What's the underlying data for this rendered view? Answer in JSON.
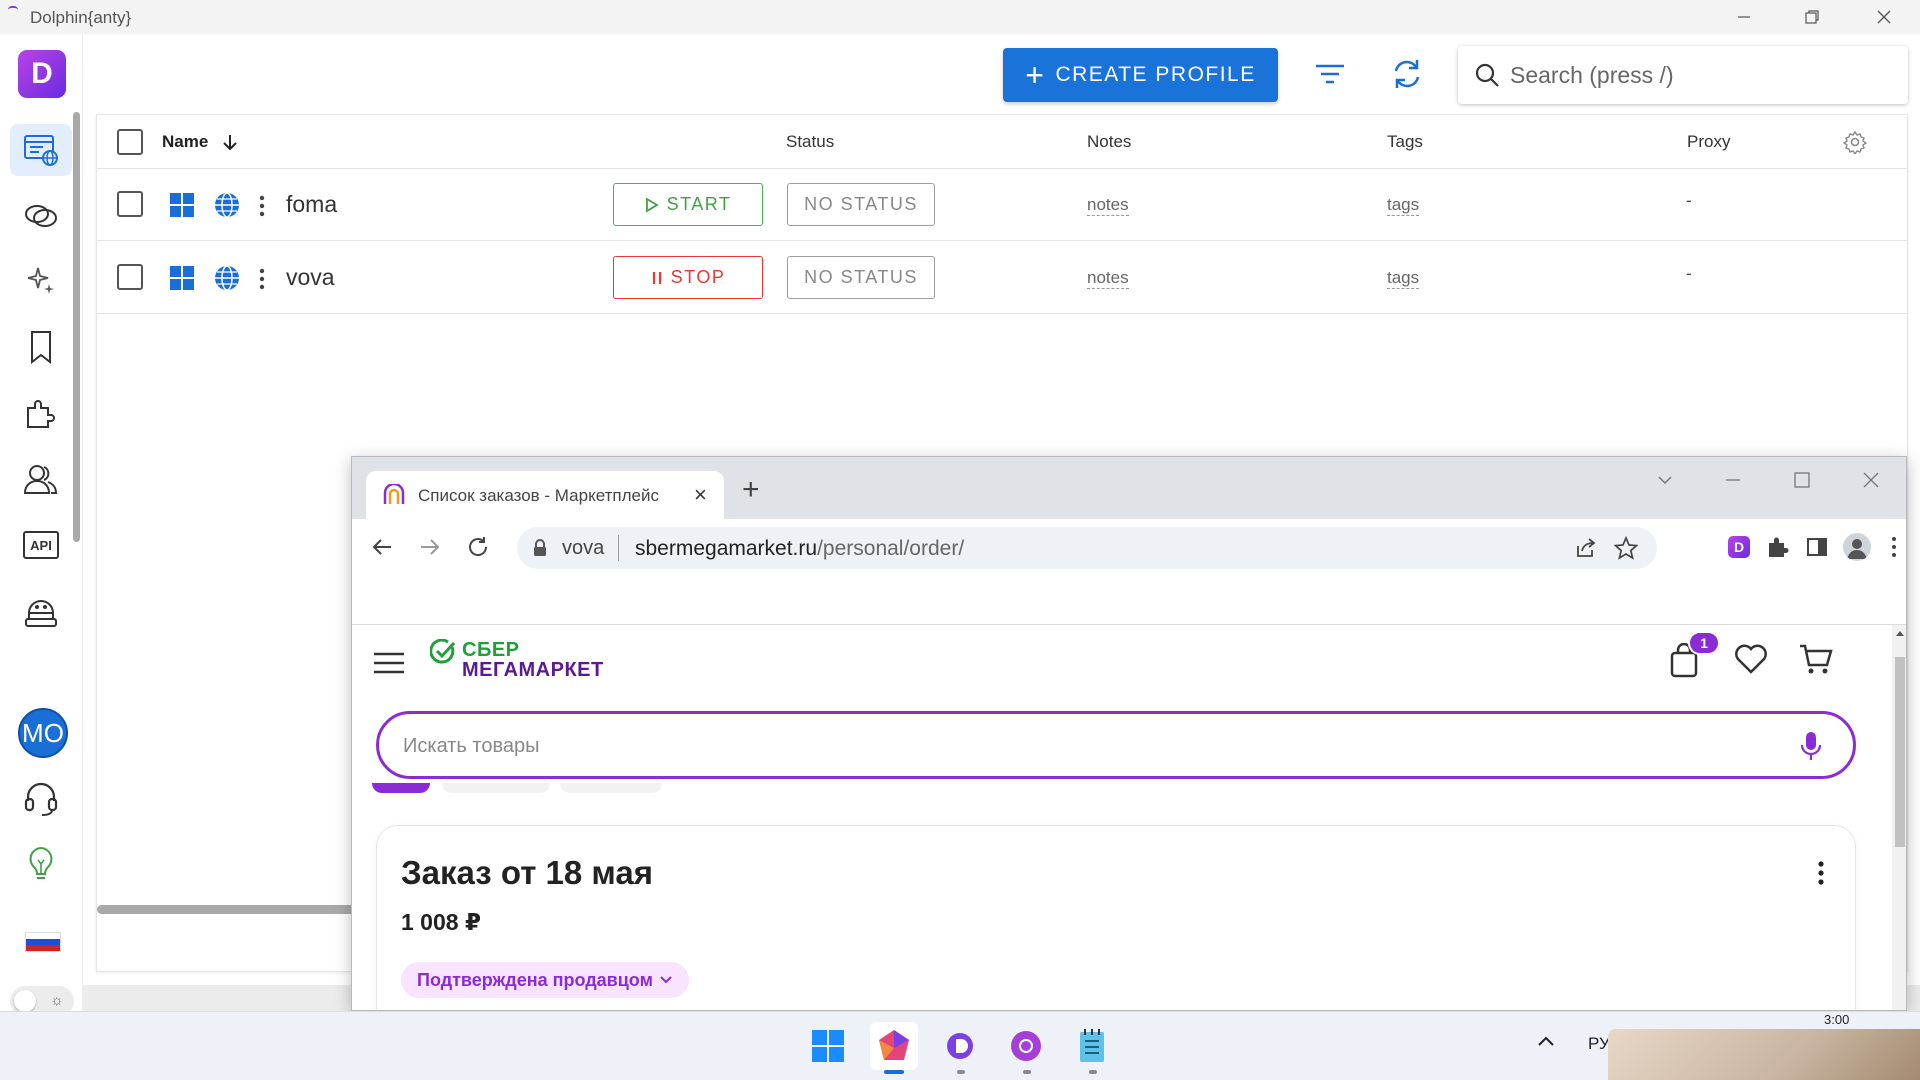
{
  "window": {
    "title": "Dolphin{anty}"
  },
  "sidebar": {
    "avatar_initials": "MO",
    "items": [
      {
        "name": "browser-profiles",
        "icon": "browser-profiles-icon"
      },
      {
        "name": "proxies",
        "icon": "link-icon"
      },
      {
        "name": "automation",
        "icon": "sparkles-icon"
      },
      {
        "name": "bookmarks",
        "icon": "bookmark-icon"
      },
      {
        "name": "extensions",
        "icon": "puzzle-icon"
      },
      {
        "name": "team",
        "icon": "users-icon"
      },
      {
        "name": "api",
        "icon": "api-icon",
        "label": "API"
      },
      {
        "name": "robot",
        "icon": "robot-icon"
      },
      {
        "name": "support",
        "icon": "headset-icon"
      },
      {
        "name": "ideas",
        "icon": "lightbulb-icon"
      }
    ]
  },
  "toolbar": {
    "create_profile_label": "CREATE PROFILE",
    "search_placeholder": "Search (press /)"
  },
  "table": {
    "columns": {
      "name": "Name",
      "status": "Status",
      "notes": "Notes",
      "tags": "Tags",
      "proxy": "Proxy"
    },
    "rows": [
      {
        "name": "foma",
        "action": "START",
        "status": "NO STATUS",
        "notes": "notes",
        "tags": "tags",
        "proxy": "-"
      },
      {
        "name": "vova",
        "action": "STOP",
        "status": "NO STATUS",
        "notes": "notes",
        "tags": "tags",
        "proxy": "-"
      }
    ]
  },
  "browser": {
    "tab_title": "Список заказов - Маркетплейс",
    "profile_name": "vova",
    "url_host": "sbermegamarket.ru",
    "url_path": "/personal/order/",
    "page": {
      "logo_line1": "СБЕР",
      "logo_line2": "МЕГАМАРКЕТ",
      "cart_count": "1",
      "search_placeholder": "Искать товары",
      "order_title": "Заказ от 18 мая",
      "order_sum": "1 008 ₽",
      "order_status": "Подтверждена продавцом"
    }
  },
  "taskbar": {
    "lang": "РУ",
    "time": "3:00"
  },
  "colors": {
    "accent_blue": "#1a73d8",
    "start_green": "#43a047",
    "stop_red": "#e53935",
    "sber_purple": "#8b2bd4",
    "sber_green": "#21a038"
  }
}
